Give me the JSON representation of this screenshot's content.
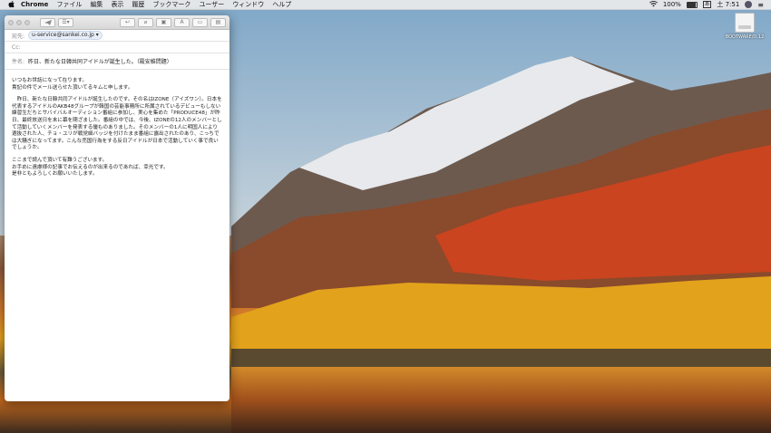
{
  "menubar": {
    "app_name": "Chrome",
    "menus": [
      "ファイル",
      "編集",
      "表示",
      "履歴",
      "ブックマーク",
      "ユーザー",
      "ウィンドウ",
      "ヘルプ"
    ],
    "battery": "100%",
    "clock": "土 7:51",
    "input_method": "あ"
  },
  "desktop": {
    "drive_label": "BOOTWARE/D.12"
  },
  "mail": {
    "toolbar_buttons": [
      "send-icon",
      "list-icon",
      "back-icon",
      "attach-icon",
      "photo-icon",
      "font-icon",
      "window-icon",
      "template-icon"
    ],
    "to_label": "宛先:",
    "to_value": "u-service@sankei.co.jp",
    "cc_label": "Cc:",
    "subject_label": "件名:",
    "subject_value": "昨日、新たな日韓共同アイドルが誕生した。（殿安維問題）",
    "body": [
      "いつもお世話になって在ります。\n貴記の件でメール送らせた頂いてるキムと申します。",
      "　昨日、新たな日韓共同アイドルが誕生したのです。その名はIZONE（アイズワン）。日本を代表するアイドルのAKB48グループが韓国の芸能事務所に所属されているデビューもしない練習生だちとサバイバルオーディション番組に参加し、実心を集めた「PRODUCE48」が昨日、最終放送日を末に幕を閉ざました。番組の中では、今後、IZONEの12人のメンバーとして活動していくメンバーを発表する優ものありました。そのメンバーの1人に明国人により選抜された人、チョ・ユリが戦党細バッジを付けたまま番組に露出されたのあり、こっちでは大騒ぎになってます。こんな売国行為をする反日アイドルが日本で活動していく事で良いでしょうか。",
      "ここまで読んで頂いて有難うございます。\nお手めに遠慮様の記事でお伝えるのが出来るのであれば、幸光です。\n是非ともよろしくお願いいたします。"
    ]
  }
}
